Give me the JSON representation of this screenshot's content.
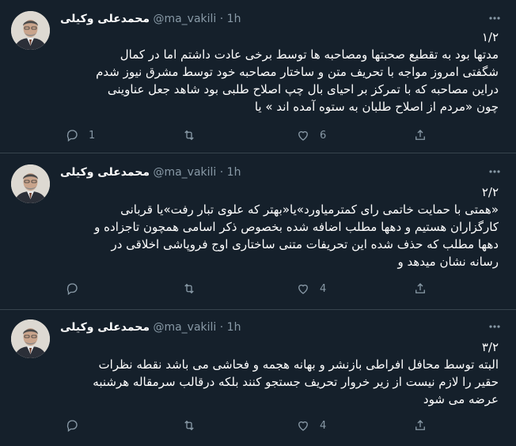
{
  "tweets": [
    {
      "author_name": "محمدعلی وکیلی",
      "handle": "@ma_vakili",
      "separator": "·",
      "time": "1h",
      "lines": [
        "۱/۲",
        "مدتها بود به تقطیع صحبتها ومصاحبه ها توسط برخی عادت داشتم اما در کمال",
        "شگفتی امروز مواجه با تحریف متن و ساختار مصاحبه خود توسط مشرق نیوز شدم",
        "دراین مصاحبه که با تمرکز بر احیای بال چپ اصلاح طلبی بود شاهد جعل عناوینی",
        "چون «مردم از اصلاح طلبان به ستوه آمده اند » یا"
      ],
      "reply_count": "1",
      "retweet_count": "",
      "like_count": "6"
    },
    {
      "author_name": "محمدعلی وکیلی",
      "handle": "@ma_vakili",
      "separator": "·",
      "time": "1h",
      "lines": [
        "۲/۲",
        "«همتی با حمایت خاتمی رای کمترمیاورد»یا«بهتر که علوی تبار رفت»یا قربانی",
        "کارگزاران هستیم و دهها مطلب اضافه شده بخصوص ذکر اسامی همچون تاجزاده و",
        "دهها مطلب که حذف شده این تحریفات متنی ساختاری اوج فروپاشی اخلاقی در",
        "رسانه نشان میدهد و"
      ],
      "reply_count": "",
      "retweet_count": "",
      "like_count": "4"
    },
    {
      "author_name": "محمدعلی وکیلی",
      "handle": "@ma_vakili",
      "separator": "·",
      "time": "1h",
      "lines": [
        "۳/۲",
        "البته توسط محافل افراطی بازنشر و بهانه هجمه و فحاشی می باشد نقطه نظرات",
        "حقیر را لازم نیست از زیر خروار تحریف جستجو کنند بلکه درقالب سرمقاله هرشنبه",
        "عرضه می شود"
      ],
      "reply_count": "",
      "retweet_count": "",
      "like_count": "4"
    }
  ],
  "icons": {
    "reply": "reply-icon",
    "retweet": "retweet-icon",
    "like": "like-icon",
    "share": "share-icon",
    "more": "more-icon"
  },
  "colors": {
    "background": "#15202b",
    "secondary_text": "#8899a6",
    "divider": "#38444d"
  }
}
